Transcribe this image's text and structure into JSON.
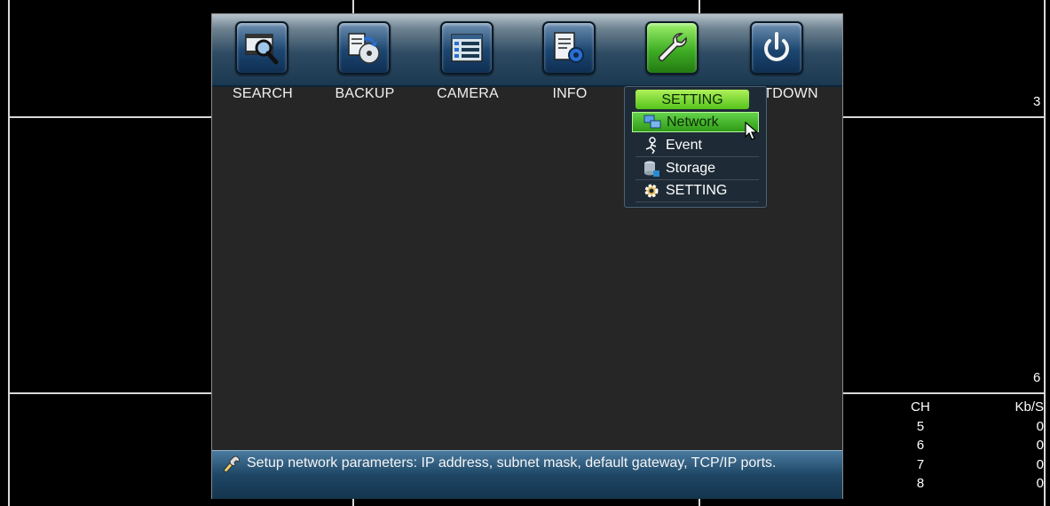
{
  "channels": {
    "labels": [
      "3",
      "6"
    ],
    "stats": {
      "header": [
        "CH",
        "Kb/S"
      ],
      "rows": [
        [
          "5",
          "0"
        ],
        [
          "6",
          "0"
        ],
        [
          "7",
          "0"
        ],
        [
          "8",
          "0"
        ]
      ]
    }
  },
  "main_menu": {
    "items": [
      {
        "label": "SEARCH",
        "icon": "search-film-icon"
      },
      {
        "label": "BACKUP",
        "icon": "backup-disc-icon"
      },
      {
        "label": "CAMERA",
        "icon": "camera-list-icon"
      },
      {
        "label": "INFO",
        "icon": "info-document-icon"
      },
      {
        "label": "SETTING",
        "icon": "wrench-icon",
        "active": true
      },
      {
        "label": "TDOWN",
        "icon": "power-icon"
      }
    ]
  },
  "dropdown": {
    "title": "SETTING",
    "items": [
      {
        "label": "Network",
        "icon": "network-icon",
        "selected": true
      },
      {
        "label": "Event",
        "icon": "event-icon"
      },
      {
        "label": "Storage",
        "icon": "storage-icon"
      },
      {
        "label": "SETTING",
        "icon": "gear-icon"
      }
    ]
  },
  "status_bar": {
    "icon": "wrench-pencil-icon",
    "text": "Setup network parameters: IP address, subnet mask, default gateway, TCP/IP ports."
  },
  "colors": {
    "active_green": "#3fae25",
    "toolbar_blue": "#1a3850",
    "window_bg": "#262626"
  }
}
